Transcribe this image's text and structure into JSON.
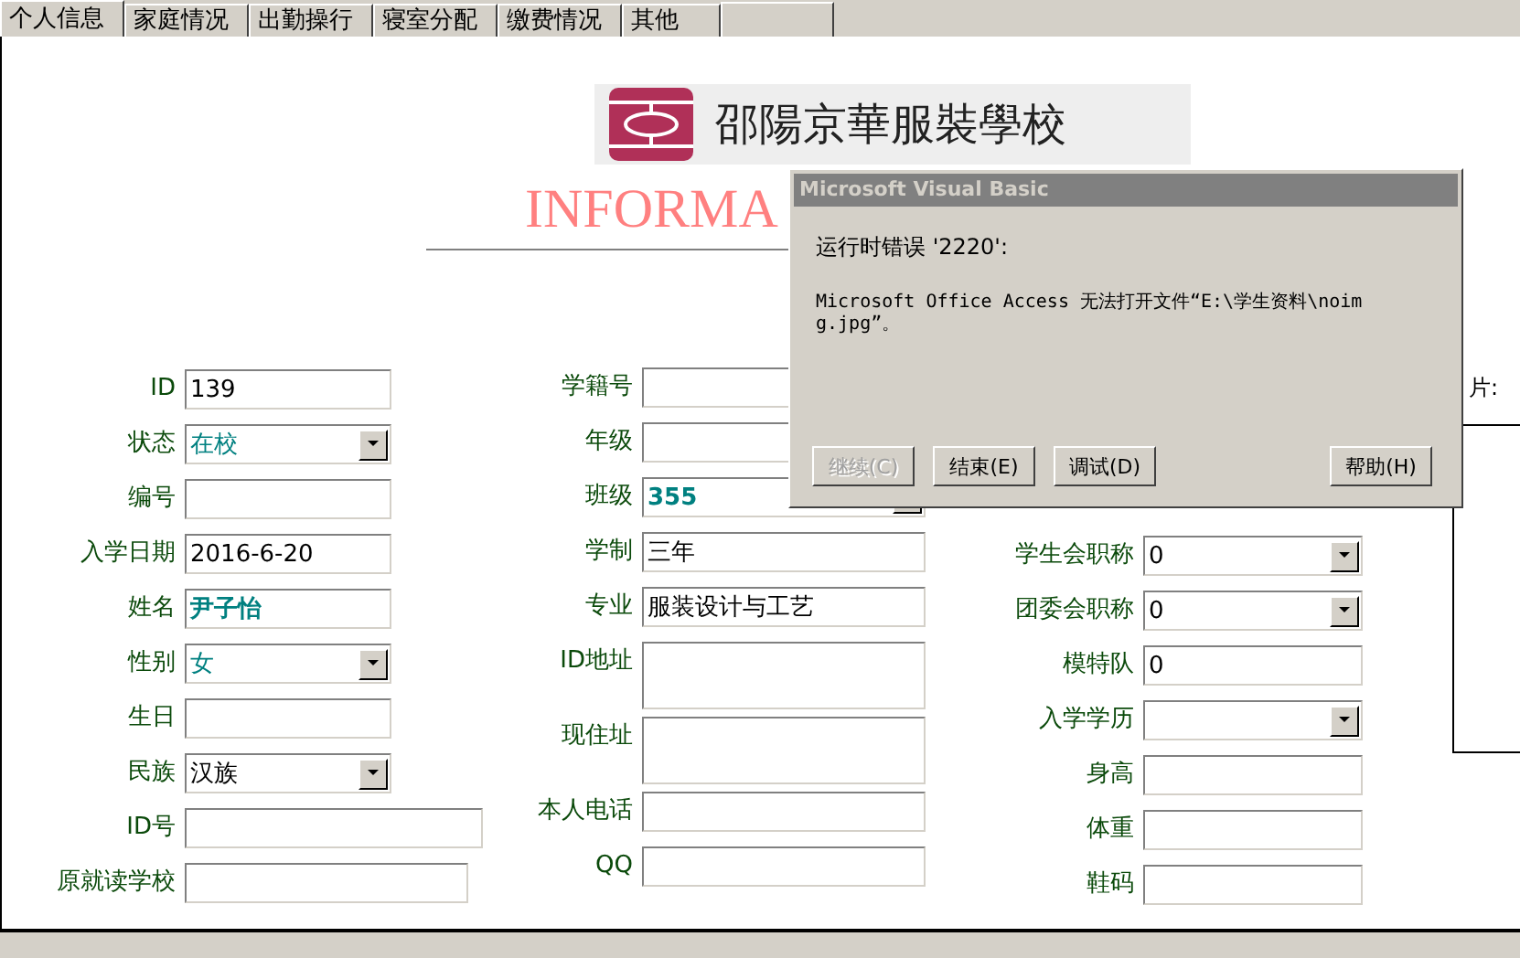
{
  "tabs": [
    {
      "label": "个人信息",
      "selected": true
    },
    {
      "label": "家庭情况",
      "selected": false
    },
    {
      "label": "出勤操行",
      "selected": false
    },
    {
      "label": "寝室分配",
      "selected": false
    },
    {
      "label": "缴费情况",
      "selected": false
    },
    {
      "label": "其他",
      "selected": false
    }
  ],
  "header": {
    "school_name": "邵陽京華服裝學校",
    "title": "INFORMA"
  },
  "photo": {
    "label": "片:"
  },
  "columns": [
    [
      {
        "label": "ID",
        "value": "139",
        "kind": "text",
        "highlighted": false,
        "bold": false
      },
      {
        "label": "状态",
        "value": "在校",
        "kind": "dropdown",
        "highlighted": true,
        "bold": false
      },
      {
        "label": "编号",
        "kind": "text"
      },
      {
        "label": "入学日期",
        "value": "2016-6-20",
        "kind": "text",
        "highlighted": false,
        "bold": false
      },
      {
        "label": "姓名",
        "value": "尹子怡",
        "kind": "text",
        "highlighted": true,
        "bold": true
      },
      {
        "label": "性别",
        "value": "女",
        "kind": "dropdown",
        "highlighted": true,
        "bold": false
      },
      {
        "label": "生日",
        "kind": "text"
      },
      {
        "label": "民族",
        "value": "汉族",
        "kind": "dropdown",
        "highlighted": false,
        "bold": false
      },
      {
        "label": "ID号",
        "kind": "wide"
      },
      {
        "label": "原就读学校",
        "kind": "wide"
      }
    ],
    [
      {
        "label": "学籍号",
        "kind": "text"
      },
      {
        "label": "年级",
        "kind": "text"
      },
      {
        "label": "班级",
        "value": "355",
        "kind": "dropdown",
        "highlighted": true,
        "bold": true
      },
      {
        "label": "学制",
        "value": "三年",
        "kind": "text",
        "highlighted": false,
        "bold": false
      },
      {
        "label": "专业",
        "value": "服装设计与工艺",
        "kind": "text",
        "highlighted": false,
        "bold": false
      },
      {
        "label": "ID地址",
        "kind": "area"
      },
      {
        "label": "现住址",
        "kind": "area"
      },
      {
        "label": "本人电话",
        "kind": "text"
      },
      {
        "label": "QQ",
        "kind": "text"
      }
    ],
    [
      {
        "label": "学生会职称",
        "value": "0",
        "kind": "dropdown",
        "highlighted": false,
        "bold": false
      },
      {
        "label": "团委会职称",
        "value": "0",
        "kind": "dropdown",
        "highlighted": false,
        "bold": false
      },
      {
        "label": "模特队",
        "value": "0",
        "kind": "text",
        "highlighted": false,
        "bold": false
      },
      {
        "label": "入学学历",
        "kind": "dropdown"
      },
      {
        "label": "身高",
        "kind": "text"
      },
      {
        "label": "体重",
        "kind": "text"
      },
      {
        "label": "鞋码",
        "kind": "text"
      }
    ]
  ],
  "dialog": {
    "title": "Microsoft Visual Basic",
    "error": "运行时错误 '2220':",
    "message": "Microsoft Office Access 无法打开文件“E:\\学生资料\\noimg.jpg”。",
    "buttons": [
      {
        "label": "继续(C)",
        "disabled": true
      },
      {
        "label": "结束(E)",
        "disabled": false
      },
      {
        "label": "调试(D)",
        "disabled": false
      },
      {
        "label": "帮助(H)",
        "disabled": false
      }
    ]
  }
}
